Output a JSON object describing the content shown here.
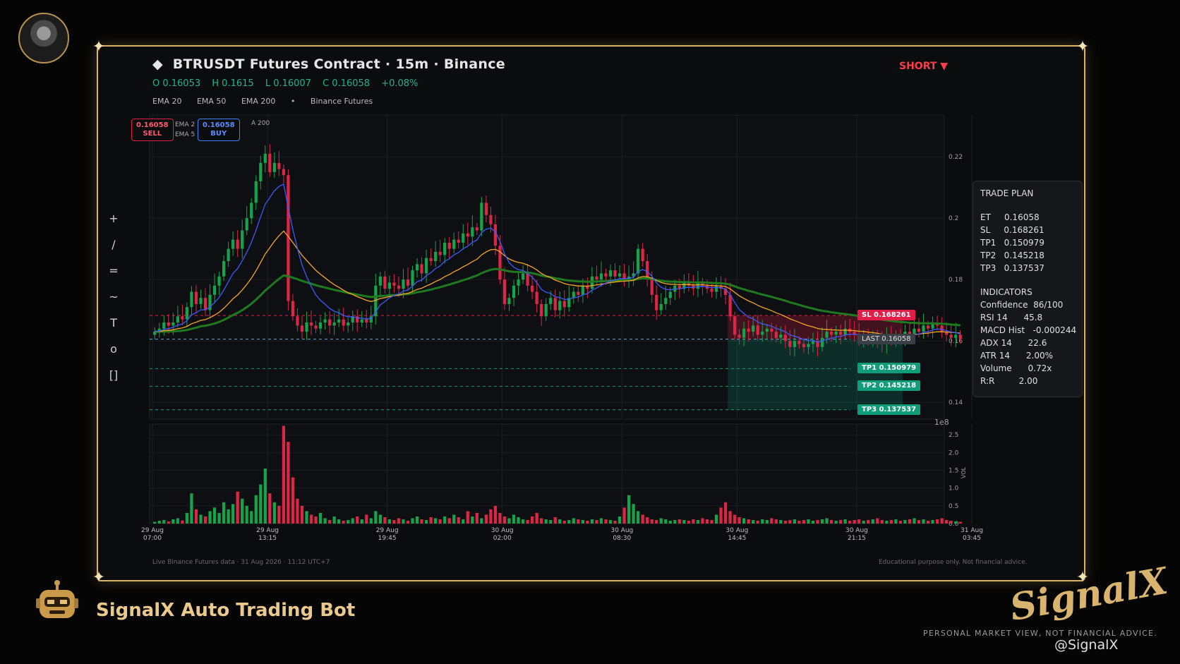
{
  "header": {
    "title": "BTRUSDT Futures Contract  ·  15m  ·  Binance",
    "side": "SHORT ▼",
    "ohlc": {
      "o": "O 0.16053",
      "h": "H 0.1615",
      "l": "L 0.16007",
      "c": "C 0.16058",
      "chg": "+0.08%"
    },
    "legend": {
      "ema20": "EMA 20",
      "ema50": "EMA 50",
      "ema200": "EMA 200",
      "dot": "•",
      "source": "Binance Futures"
    }
  },
  "orders": {
    "sell_price": "0.16058",
    "sell_label": "SELL",
    "buy_price": "0.16058",
    "buy_label": "BUY",
    "ghost_ema20": "EMA 2",
    "ghost_ema50": "EMA 5",
    "ghost_ema200": "A 200"
  },
  "tools": [
    "+",
    "/",
    "=",
    "~",
    "T",
    "o",
    "[]"
  ],
  "levels": {
    "sl": "SL  0.168261",
    "last": "LAST  0.16058",
    "tp1": "TP1  0.150979",
    "tp2": "TP2  0.145218",
    "tp3": "TP3  0.137537"
  },
  "trade_plan": {
    "heading": "TRADE PLAN",
    "rows": [
      "ET     0.16058",
      "SL     0.168261",
      "TP1   0.150979",
      "TP2   0.145218",
      "TP3   0.137537"
    ],
    "ind_heading": "INDICATORS",
    "ind_rows": [
      "Confidence  86/100",
      "RSI 14      45.8",
      "MACD Hist   -0.000244",
      "ADX 14      22.6",
      "ATR 14      2.00%",
      "Volume      0.72x",
      "R:R         2.00"
    ]
  },
  "chart_data": {
    "type": "candlestick",
    "price_ticks": [
      "0.22",
      "0.2",
      "0.18",
      "0.16",
      "0.14"
    ],
    "price_tick_values": [
      0.22,
      0.2,
      0.18,
      0.16,
      0.14
    ],
    "ylim": [
      0.1345,
      0.2336
    ],
    "exponent_label": "1e8",
    "vol_ticks": [
      "2.5",
      "2.0",
      "1.5",
      "1.0",
      "0.5",
      "0.0"
    ],
    "vol_tick_values": [
      2.5,
      2.0,
      1.5,
      1.0,
      0.5,
      0.0
    ],
    "vol_ylim": [
      0,
      2.8
    ],
    "vol_label": "VOL",
    "x_ticks": [
      {
        "i": 0,
        "l1": "29 Aug",
        "l2": "07:00"
      },
      {
        "i": 25,
        "l1": "29 Aug",
        "l2": "13:15"
      },
      {
        "i": 51,
        "l1": "29 Aug",
        "l2": "19:45"
      },
      {
        "i": 76,
        "l1": "30 Aug",
        "l2": "02:00"
      },
      {
        "i": 102,
        "l1": "30 Aug",
        "l2": "08:30"
      },
      {
        "i": 127,
        "l1": "30 Aug",
        "l2": "14:45"
      },
      {
        "i": 153,
        "l1": "30 Aug",
        "l2": "21:15"
      },
      {
        "i": 178,
        "l1": "31 Aug",
        "l2": "03:45"
      }
    ],
    "bars": 178,
    "closes": [
      0.163,
      0.164,
      0.166,
      0.165,
      0.166,
      0.168,
      0.167,
      0.171,
      0.176,
      0.172,
      0.174,
      0.17,
      0.175,
      0.178,
      0.181,
      0.186,
      0.19,
      0.193,
      0.19,
      0.196,
      0.2,
      0.205,
      0.212,
      0.218,
      0.221,
      0.215,
      0.218,
      0.216,
      0.214,
      0.173,
      0.168,
      0.165,
      0.163,
      0.166,
      0.165,
      0.164,
      0.166,
      0.167,
      0.165,
      0.166,
      0.167,
      0.165,
      0.166,
      0.168,
      0.166,
      0.167,
      0.166,
      0.168,
      0.178,
      0.181,
      0.177,
      0.179,
      0.178,
      0.177,
      0.18,
      0.178,
      0.183,
      0.185,
      0.182,
      0.187,
      0.186,
      0.189,
      0.188,
      0.192,
      0.19,
      0.193,
      0.192,
      0.195,
      0.194,
      0.197,
      0.196,
      0.205,
      0.201,
      0.198,
      0.191,
      0.18,
      0.172,
      0.174,
      0.178,
      0.18,
      0.182,
      0.178,
      0.176,
      0.172,
      0.168,
      0.172,
      0.174,
      0.17,
      0.173,
      0.171,
      0.174,
      0.176,
      0.175,
      0.178,
      0.177,
      0.181,
      0.18,
      0.182,
      0.181,
      0.183,
      0.181,
      0.182,
      0.18,
      0.181,
      0.182,
      0.19,
      0.186,
      0.18,
      0.175,
      0.17,
      0.172,
      0.174,
      0.176,
      0.178,
      0.177,
      0.179,
      0.178,
      0.177,
      0.179,
      0.178,
      0.177,
      0.176,
      0.178,
      0.177,
      0.175,
      0.168,
      0.162,
      0.161,
      0.164,
      0.163,
      0.165,
      0.162,
      0.163,
      0.164,
      0.163,
      0.161,
      0.162,
      0.16,
      0.158,
      0.16,
      0.159,
      0.158,
      0.159,
      0.16,
      0.158,
      0.161,
      0.163,
      0.162,
      0.163,
      0.162,
      0.164,
      0.163,
      0.162,
      0.161,
      0.162,
      0.16,
      0.161,
      0.16,
      0.159,
      0.161,
      0.16,
      0.162,
      0.161,
      0.163,
      0.162,
      0.164,
      0.163,
      0.165,
      0.164,
      0.166,
      0.165,
      0.163,
      0.162,
      0.161,
      0.162,
      0.16058
    ],
    "volumes": [
      0.05,
      0.08,
      0.1,
      0.06,
      0.12,
      0.15,
      0.09,
      0.3,
      0.85,
      0.4,
      0.25,
      0.2,
      0.35,
      0.45,
      0.3,
      0.6,
      0.4,
      0.55,
      0.9,
      0.7,
      0.5,
      0.35,
      0.8,
      1.1,
      1.55,
      0.85,
      0.6,
      0.5,
      2.75,
      2.3,
      1.3,
      0.7,
      0.5,
      0.35,
      0.25,
      0.2,
      0.3,
      0.15,
      0.1,
      0.2,
      0.12,
      0.08,
      0.1,
      0.15,
      0.2,
      0.12,
      0.25,
      0.15,
      0.35,
      0.25,
      0.18,
      0.12,
      0.1,
      0.15,
      0.12,
      0.08,
      0.15,
      0.2,
      0.12,
      0.1,
      0.18,
      0.15,
      0.12,
      0.2,
      0.15,
      0.25,
      0.18,
      0.12,
      0.35,
      0.2,
      0.3,
      0.15,
      0.25,
      0.4,
      0.5,
      0.3,
      0.2,
      0.15,
      0.25,
      0.18,
      0.12,
      0.1,
      0.2,
      0.3,
      0.15,
      0.12,
      0.1,
      0.18,
      0.12,
      0.08,
      0.1,
      0.15,
      0.12,
      0.1,
      0.08,
      0.12,
      0.1,
      0.15,
      0.12,
      0.1,
      0.08,
      0.2,
      0.45,
      0.8,
      0.55,
      0.35,
      0.25,
      0.18,
      0.12,
      0.1,
      0.15,
      0.12,
      0.08,
      0.1,
      0.12,
      0.1,
      0.08,
      0.12,
      0.1,
      0.15,
      0.12,
      0.1,
      0.25,
      0.45,
      0.6,
      0.35,
      0.25,
      0.18,
      0.15,
      0.12,
      0.1,
      0.08,
      0.12,
      0.1,
      0.15,
      0.12,
      0.1,
      0.08,
      0.1,
      0.12,
      0.08,
      0.1,
      0.12,
      0.08,
      0.1,
      0.12,
      0.15,
      0.1,
      0.08,
      0.1,
      0.12,
      0.08,
      0.1,
      0.12,
      0.08,
      0.1,
      0.12,
      0.15,
      0.1,
      0.08,
      0.1,
      0.12,
      0.08,
      0.1,
      0.12,
      0.15,
      0.1,
      0.12,
      0.08,
      0.1,
      0.12,
      0.15,
      0.1,
      0.08,
      0.06,
      0.05,
      0.04,
      0.05
    ],
    "ema20_color": "#3d5afe",
    "ema50_color": "#f5a623",
    "ema200_color": "#1f7a1f",
    "up_color": "#16a34a",
    "down_color": "#dc2646",
    "sl": 0.168261,
    "last": 0.16058,
    "tp1": 0.150979,
    "tp2": 0.145218,
    "tp3": 0.137537,
    "zone_start_index": 125,
    "zone_end_index": 163
  },
  "footer": {
    "left": "Live Binance Futures data  ·  31 Aug 2026 · 11:12 UTC+7",
    "right": "Educational purpose only. Not financial advice.",
    "brand": "SignalX Auto Trading Bot",
    "logo": "SignalX",
    "tagline": "PERSONAL MARKET VIEW, NOT FINANCIAL ADVICE.",
    "handle": "@SignalX"
  },
  "colors": {
    "gold": "#d9b46a",
    "sl": "#e11d48",
    "tp": "#0f9d7a",
    "last": "#3a3f47"
  }
}
